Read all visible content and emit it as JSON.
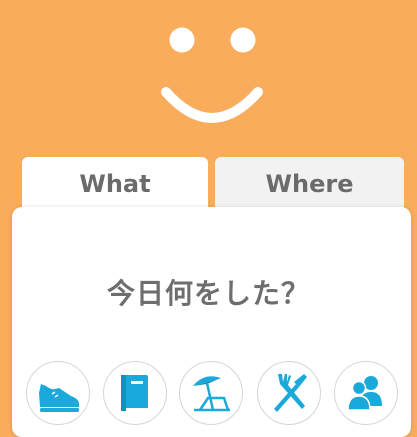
{
  "accent_color": "#F8AC5C",
  "icon_color": "#1AA9DA",
  "header": {
    "logo_icon": "smiley-face-icon"
  },
  "tabs": [
    {
      "label": "What",
      "selected": true
    },
    {
      "label": "Where",
      "selected": false
    }
  ],
  "main": {
    "question": "今日何をした？"
  },
  "activities": [
    {
      "icon": "shoe-icon"
    },
    {
      "icon": "book-icon"
    },
    {
      "icon": "beach-umbrella-icon"
    },
    {
      "icon": "fork-knife-icon"
    },
    {
      "icon": "people-icon"
    }
  ]
}
